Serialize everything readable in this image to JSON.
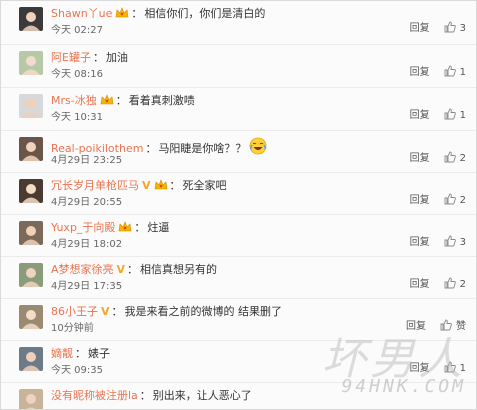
{
  "comments": [
    {
      "username": "Shawn丫ue",
      "badge": "vip-crown",
      "v_badge": "",
      "text": "相信你们，你们是清白的",
      "time": "今天 02:27",
      "reply_label": "回复",
      "likes": "3",
      "avatar_color": "#3a3a3a"
    },
    {
      "username": "阿E罐子",
      "badge": "",
      "v_badge": "",
      "text": "加油",
      "time": "今天 08:16",
      "reply_label": "回复",
      "likes": "1",
      "avatar_color": "#b8c9a8"
    },
    {
      "username": "Mrs-冰独",
      "badge": "vip-crown",
      "v_badge": "",
      "text": "看着真刺激啧",
      "time": "今天 10:31",
      "reply_label": "回复",
      "likes": "1",
      "avatar_color": "#d8d8d8"
    },
    {
      "username": "Real-poikilothem",
      "badge": "",
      "v_badge": "",
      "text": "马阳睫是你啥？？",
      "emoji": "laugh-cry",
      "time": "4月29日 23:25",
      "reply_label": "回复",
      "likes": "2",
      "avatar_color": "#6a5648"
    },
    {
      "username": "冗长岁月单枪匹马",
      "badge": "vip-crown",
      "v_badge": "V",
      "text": "死全家吧",
      "time": "4月29日 20:55",
      "reply_label": "回复",
      "likes": "2",
      "avatar_color": "#4a3a32"
    },
    {
      "username": "Yuxp_于向殿",
      "badge": "vip-crown",
      "v_badge": "",
      "text": "炷逼",
      "time": "4月29日 18:02",
      "reply_label": "回复",
      "likes": "3",
      "avatar_color": "#7b6a5a"
    },
    {
      "username": "A梦想家徐亮",
      "badge": "",
      "v_badge": "V",
      "text": "相信真想另有的",
      "time": "4月29日 17:35",
      "reply_label": "回复",
      "likes": "2",
      "avatar_color": "#8a9c7a"
    },
    {
      "username": "86小王子",
      "badge": "",
      "v_badge": "V",
      "text": "我是来看之前的微博的 结果删了",
      "time": "10分钟前",
      "reply_label": "回复",
      "likes": "赞",
      "avatar_color": "#9a8a72"
    },
    {
      "username": "嫡靓",
      "badge": "",
      "v_badge": "",
      "text": "婊子",
      "time": "今天 09:35",
      "reply_label": "回复",
      "likes": "1",
      "avatar_color": "#6d7a88"
    },
    {
      "username": "没有昵称被注册la",
      "badge": "",
      "v_badge": "",
      "text": "别出来，让人恶心了",
      "time": "",
      "reply_label": "",
      "likes": "",
      "avatar_color": "#c9b49a"
    }
  ],
  "watermark": {
    "logo": "坏男人",
    "url": "94HNK.COM"
  },
  "colors": {
    "username": "#eb7350",
    "v_badge": "#f5a623",
    "text": "#333333",
    "meta": "#666666"
  }
}
